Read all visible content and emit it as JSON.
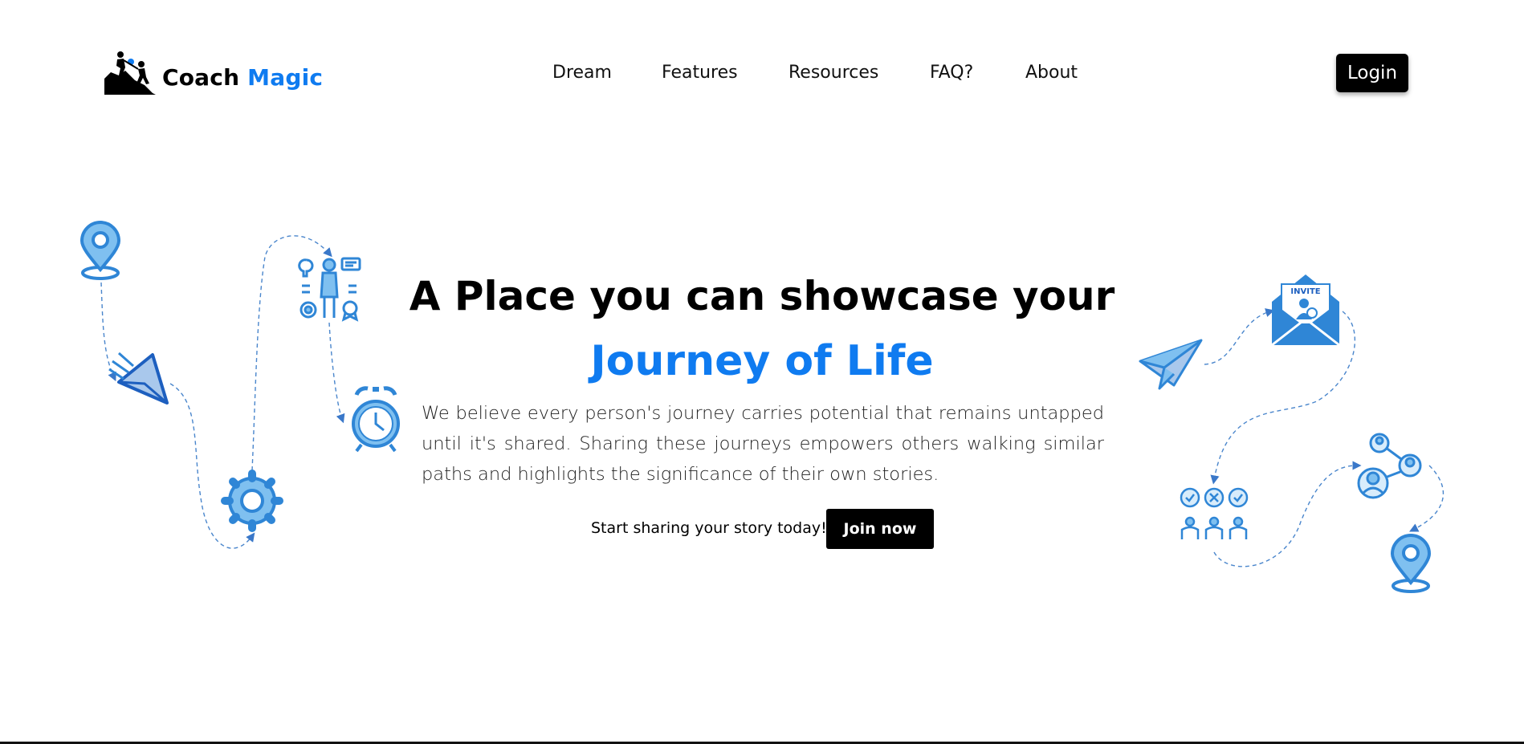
{
  "header": {
    "logo": {
      "word1": "Coach",
      "word2": "Magic"
    },
    "nav": [
      {
        "label": "Dream"
      },
      {
        "label": "Features"
      },
      {
        "label": "Resources"
      },
      {
        "label": "FAQ?"
      },
      {
        "label": "About"
      }
    ],
    "login_label": "Login"
  },
  "hero": {
    "title_line1": "A Place you can showcase your",
    "title_line2": "Journey of Life",
    "description": "We believe every person's journey carries potential that remains untapped until it's shared. Sharing these journeys empowers others walking similar paths and highlights the significance of their own stories.",
    "cta_text": "Start sharing your story today!",
    "join_label": "Join now"
  },
  "illustration": {
    "invite_text": "INVITE",
    "icons": [
      "location-pin-icon",
      "paper-plane-icon",
      "gear-icon",
      "idea-person-icon",
      "alarm-clock-icon",
      "invite-envelope-icon",
      "voting-people-icon",
      "network-users-icon"
    ]
  },
  "colors": {
    "accent": "#0f7bf0",
    "icon_blue": "#2f86d6",
    "icon_light": "#7fc0f0",
    "button_bg": "#000000"
  }
}
